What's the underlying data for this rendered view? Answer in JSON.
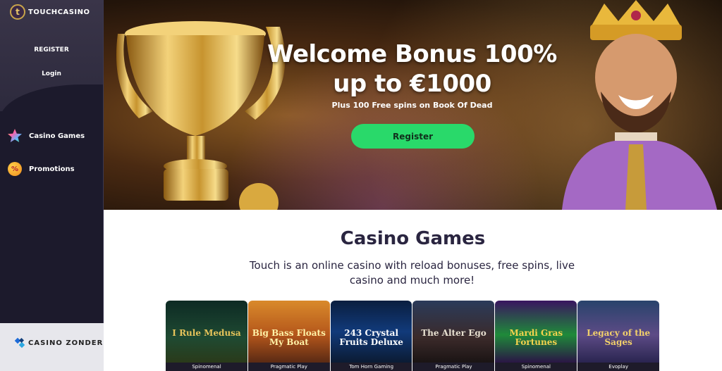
{
  "brand": {
    "logo_letter": "t",
    "name": "TOUCHCASINO"
  },
  "sidebar": {
    "register_label": "REGISTER",
    "login_label": "Login",
    "nav": [
      {
        "label": "Casino Games",
        "icon": "star-icon"
      },
      {
        "label": "Promotions",
        "icon": "percent-badge-icon"
      }
    ]
  },
  "hero": {
    "title_line1": "Welcome Bonus 100%",
    "title_line2": "up to €1000",
    "subtitle": "Plus 100 Free spins on Book Of Dead",
    "cta_label": "Register",
    "cta_color": "#29d96a"
  },
  "section": {
    "title": "Casino Games",
    "description": "Touch is an online casino with reload bonuses, free spins, live casino and much more!"
  },
  "games": [
    {
      "title": "I Rule Medusa",
      "provider": "Spinomenal"
    },
    {
      "title": "Big Bass Floats My Boat",
      "provider": "Pragmatic Play"
    },
    {
      "title": "243 Crystal Fruits Deluxe",
      "provider": "Tom Horn Gaming"
    },
    {
      "title": "The Alter Ego",
      "provider": "Pragmatic Play"
    },
    {
      "title": "Mardi Gras Fortunes",
      "provider": "Spinomenal"
    },
    {
      "title": "Legacy of the Sages",
      "provider": "Evoplay"
    }
  ],
  "watermark": {
    "text": "CASINO ZONDER ID.IN"
  }
}
